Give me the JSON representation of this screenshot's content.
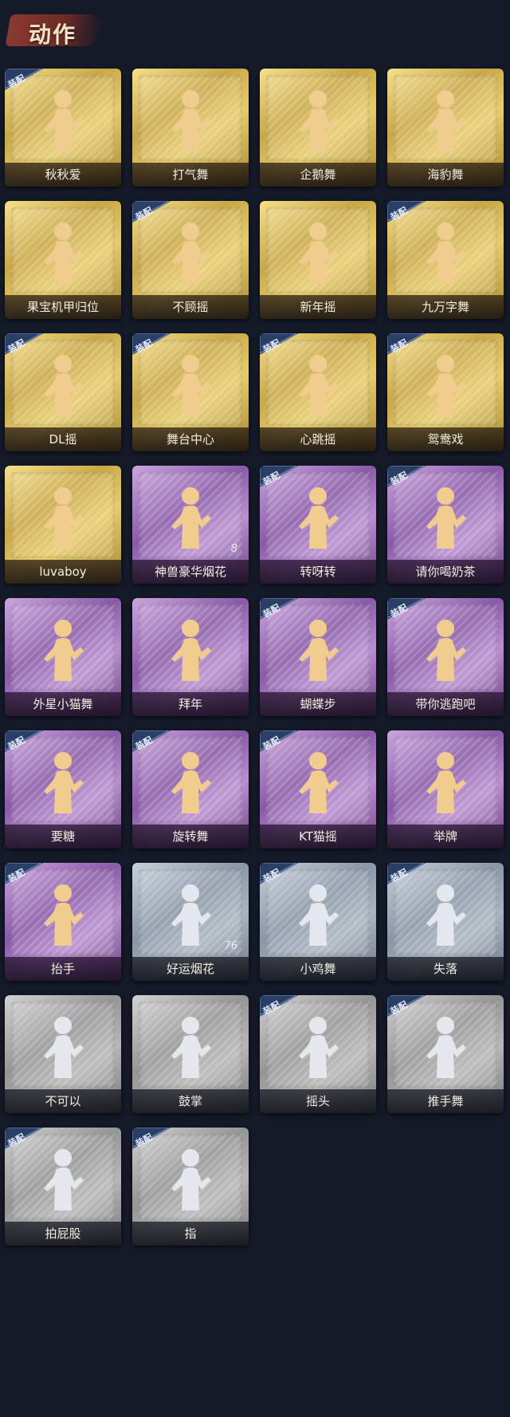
{
  "header": {
    "title": "动作"
  },
  "equipped_label": "装配",
  "colors": {
    "gold": "#d9bd58",
    "purple": "#9a6ab8",
    "silver": "#9aa6b4",
    "gray": "#a6a6a6",
    "figure_gold": "#f0cd8e",
    "figure_silver": "#e4e8ee"
  },
  "actions": [
    {
      "label": "秋秋爱",
      "rarity": "gold",
      "equipped": true,
      "icon": "dance-pose-icon"
    },
    {
      "label": "打气舞",
      "rarity": "gold",
      "equipped": false,
      "icon": "dance-pose-icon"
    },
    {
      "label": "企鹅舞",
      "rarity": "gold",
      "equipped": false,
      "icon": "dance-pose-icon"
    },
    {
      "label": "海豹舞",
      "rarity": "gold",
      "equipped": false,
      "icon": "dance-pose-icon"
    },
    {
      "label": "果宝机甲归位",
      "rarity": "gold",
      "equipped": false,
      "icon": "dance-pose-icon"
    },
    {
      "label": "不顾摇",
      "rarity": "gold",
      "equipped": true,
      "icon": "dance-pose-icon"
    },
    {
      "label": "新年摇",
      "rarity": "gold",
      "equipped": false,
      "icon": "dance-pose-icon"
    },
    {
      "label": "九万字舞",
      "rarity": "gold",
      "equipped": true,
      "icon": "dance-pose-icon"
    },
    {
      "label": "DL摇",
      "rarity": "gold",
      "equipped": true,
      "icon": "dance-pose-icon"
    },
    {
      "label": "舞台中心",
      "rarity": "gold",
      "equipped": true,
      "icon": "dance-pose-icon"
    },
    {
      "label": "心跳摇",
      "rarity": "gold",
      "equipped": true,
      "icon": "dance-pose-icon"
    },
    {
      "label": "鸳鸯戏",
      "rarity": "gold",
      "equipped": true,
      "icon": "dance-pose-icon"
    },
    {
      "label": "luvaboy",
      "rarity": "gold",
      "equipped": false,
      "icon": "dance-pose-icon"
    },
    {
      "label": "神兽豪华烟花",
      "rarity": "purple",
      "equipped": false,
      "icon": "firework-pot-icon",
      "count": "8"
    },
    {
      "label": "转呀转",
      "rarity": "purple",
      "equipped": true,
      "icon": "puppet-girl-icon"
    },
    {
      "label": "请你喝奶茶",
      "rarity": "purple",
      "equipped": true,
      "icon": "milk-tea-sign-icon"
    },
    {
      "label": "外星小猫舞",
      "rarity": "purple",
      "equipped": false,
      "icon": "dance-pose-icon"
    },
    {
      "label": "拜年",
      "rarity": "purple",
      "equipped": false,
      "icon": "dance-pose-icon"
    },
    {
      "label": "蝴蝶步",
      "rarity": "purple",
      "equipped": true,
      "icon": "dance-pose-icon"
    },
    {
      "label": "带你逃跑吧",
      "rarity": "purple",
      "equipped": true,
      "icon": "dance-pose-icon"
    },
    {
      "label": "要糖",
      "rarity": "purple",
      "equipped": true,
      "icon": "dance-pose-icon"
    },
    {
      "label": "旋转舞",
      "rarity": "purple",
      "equipped": true,
      "icon": "dance-pose-icon"
    },
    {
      "label": "KT猫摇",
      "rarity": "purple",
      "equipped": true,
      "icon": "dance-pose-icon"
    },
    {
      "label": "举牌",
      "rarity": "purple",
      "equipped": false,
      "icon": "sign-raise-icon"
    },
    {
      "label": "抬手",
      "rarity": "purple",
      "equipped": true,
      "icon": "dance-pose-icon"
    },
    {
      "label": "好运烟花",
      "rarity": "silver",
      "equipped": false,
      "icon": "firework-cylinder-icon",
      "count": "76"
    },
    {
      "label": "小鸡舞",
      "rarity": "silver",
      "equipped": true,
      "icon": "dance-pose-icon"
    },
    {
      "label": "失落",
      "rarity": "silver",
      "equipped": true,
      "icon": "crawl-pose-icon"
    },
    {
      "label": "不可以",
      "rarity": "gray",
      "equipped": false,
      "icon": "finger-wag-icon"
    },
    {
      "label": "鼓掌",
      "rarity": "gray",
      "equipped": false,
      "icon": "clap-hands-icon"
    },
    {
      "label": "摇头",
      "rarity": "gray",
      "equipped": true,
      "icon": "dance-pose-icon"
    },
    {
      "label": "推手舞",
      "rarity": "gray",
      "equipped": true,
      "icon": "dance-pose-icon"
    },
    {
      "label": "拍屁股",
      "rarity": "gray",
      "equipped": true,
      "icon": "dance-pose-icon"
    },
    {
      "label": "指",
      "rarity": "gray",
      "equipped": true,
      "icon": "point-hand-icon"
    }
  ]
}
